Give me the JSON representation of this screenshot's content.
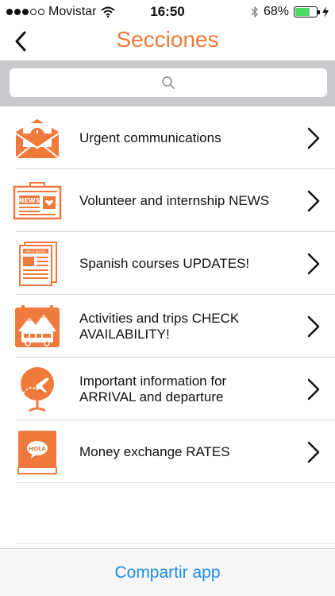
{
  "status_bar": {
    "carrier": "Movistar",
    "time": "16:50",
    "battery": "68%",
    "battery_level": 0.68
  },
  "nav": {
    "title": "Secciones",
    "back_icon": "chevron-left-icon"
  },
  "search": {
    "placeholder": "",
    "icon": "search-icon"
  },
  "sections": [
    {
      "label": "Urgent communications",
      "icon": "envelope-clock-icon"
    },
    {
      "label": "Volunteer and internship NEWS",
      "icon": "newspaper-news-icon"
    },
    {
      "label": "Spanish courses UPDATES!",
      "icon": "blog-newspaper-icon"
    },
    {
      "label": "Activities and trips CHECK AVAILABILITY!",
      "icon": "bus-mountains-icon"
    },
    {
      "label": "Important information for ARRIVAL and departure",
      "icon": "globe-plane-icon"
    },
    {
      "label": "Money exchange RATES",
      "icon": "book-hola-icon"
    }
  ],
  "bottom_bar": {
    "share_label": "Compartir app"
  },
  "colors": {
    "accent": "#f0793c",
    "link": "#1e8ce6",
    "search_bg": "#c9c9ce"
  }
}
